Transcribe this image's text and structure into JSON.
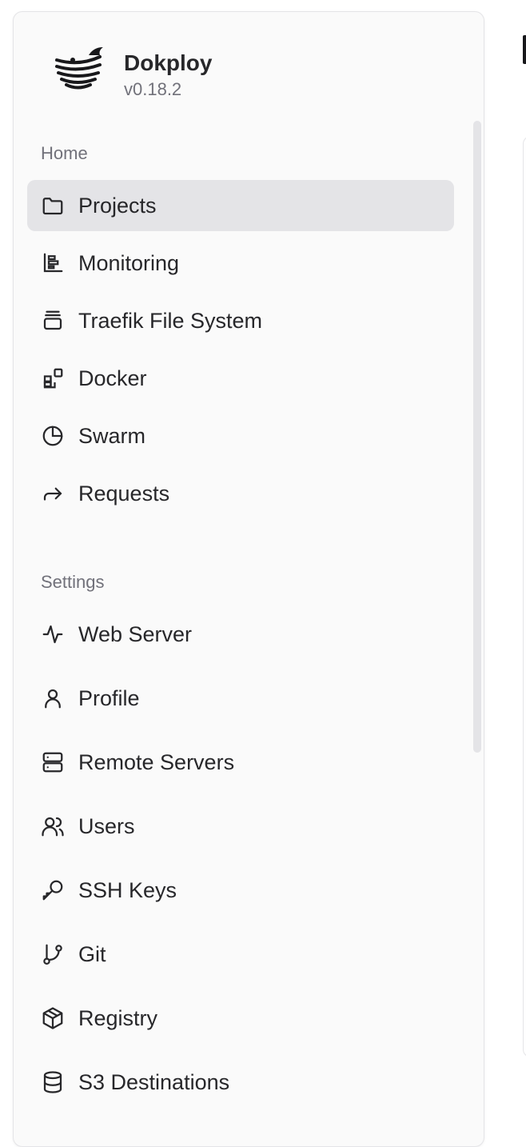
{
  "brand": {
    "name": "Dokploy",
    "version": "v0.18.2"
  },
  "sections": [
    {
      "label": "Home"
    },
    {
      "label": "Settings"
    }
  ],
  "home_items": [
    {
      "label": "Projects",
      "icon": "folder-icon",
      "active": true
    },
    {
      "label": "Monitoring",
      "icon": "bar-chart-icon"
    },
    {
      "label": "Traefik File System",
      "icon": "layers-icon"
    },
    {
      "label": "Docker",
      "icon": "blocks-icon"
    },
    {
      "label": "Swarm",
      "icon": "pie-chart-icon"
    },
    {
      "label": "Requests",
      "icon": "forward-arrow-icon"
    }
  ],
  "settings_items": [
    {
      "label": "Web Server",
      "icon": "activity-icon"
    },
    {
      "label": "Profile",
      "icon": "user-icon"
    },
    {
      "label": "Remote Servers",
      "icon": "server-icon"
    },
    {
      "label": "Users",
      "icon": "users-icon"
    },
    {
      "label": "SSH Keys",
      "icon": "key-icon"
    },
    {
      "label": "Git",
      "icon": "git-branch-icon"
    },
    {
      "label": "Registry",
      "icon": "package-icon"
    },
    {
      "label": "S3 Destinations",
      "icon": "database-icon"
    }
  ],
  "colors": {
    "active_bg": "#e4e4e7",
    "sidebar_bg": "#fafafa",
    "text": "#27272a",
    "muted": "#71717a"
  }
}
